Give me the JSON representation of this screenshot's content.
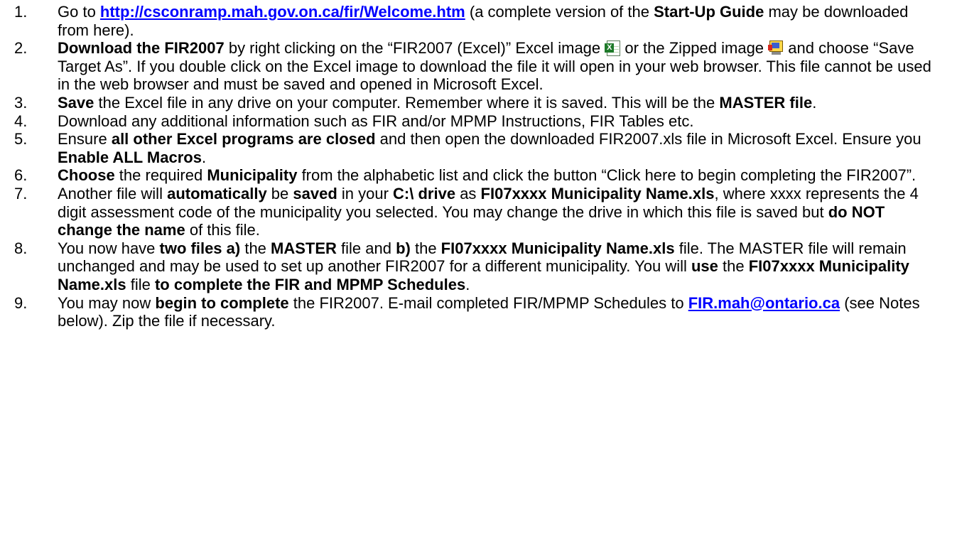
{
  "steps": [
    {
      "number": "1.",
      "t1": "Go to ",
      "link": "http://csconramp.mah.gov.on.ca/fir/Welcome.htm",
      "t2": "  (a complete version of the ",
      "b1": "Start-Up Guide",
      "t3": " may be downloaded from here)."
    },
    {
      "number": "2.",
      "b1": "Download the FIR2007",
      "t1": " by right clicking on the “FIR2007 (Excel)” Excel image ",
      "t2": " or the Zipped image  ",
      "t3": " and choose “Save Target As”.  If you double click on the Excel image to download the file it will open in your web browser.  This file cannot be used in the web browser and must be saved and opened in Microsoft Excel.",
      "excel_icon_letter": "X"
    },
    {
      "number": "3.",
      "b1": "Save",
      "t1": " the Excel file in any drive on your computer.  Remember where it is saved.  This will be the ",
      "b2": "MASTER file",
      "t2": "."
    },
    {
      "number": "4.",
      "t1": "Download any additional information such as FIR and/or MPMP Instructions, FIR Tables etc."
    },
    {
      "number": "5.",
      "t1": "Ensure ",
      "b1": "all other Excel programs are closed",
      "t2": " and then open the downloaded FIR2007.xls file in Microsoft Excel.  Ensure you ",
      "b2": "Enable ALL Macros",
      "t3": "."
    },
    {
      "number": "6.",
      "b1": "Choose",
      "t1": " the required ",
      "b2": "Municipality",
      "t2": " from the alphabetic list and click the button “Click here to begin completing the FIR2007”."
    },
    {
      "number": "7.",
      "t1": "Another file will ",
      "b1": "automatically",
      "t2": " be ",
      "b2": "saved",
      "t3": " in your ",
      "b3": "C:\\ drive",
      "t4": " as ",
      "b4": "FI07xxxx Municipality Name.xls",
      "t5": ", where xxxx represents the 4 digit assessment code of the municipality you selected.  You may change the drive in which this file is saved but ",
      "b5": "do NOT change the name",
      "t6": " of this file."
    },
    {
      "number": "8.",
      "t1": "You now have ",
      "b1": "two files a)",
      "t2": " the ",
      "b2": "MASTER",
      "t3": " file and ",
      "b3": "b)",
      "t4": " the ",
      "b4": "FI07xxxx Municipality Name.xls",
      "t5": " file.  The MASTER file will remain unchanged and may be used to set up another FIR2007 for a different municipality.  You will ",
      "b5": "use",
      "t6": " the ",
      "b6": "FI07xxxx Municipality Name.xls",
      "t7": " file ",
      "b7": "to complete the FIR and MPMP Schedules",
      "t8": "."
    },
    {
      "number": "9.",
      "t1": "You may now ",
      "b1": "begin to complete",
      "t2": " the FIR2007.  E-mail completed FIR/MPMP Schedules to ",
      "link": "FIR.mah@ontario.ca",
      "t3": "  (see Notes below).  Zip the file if necessary."
    }
  ]
}
